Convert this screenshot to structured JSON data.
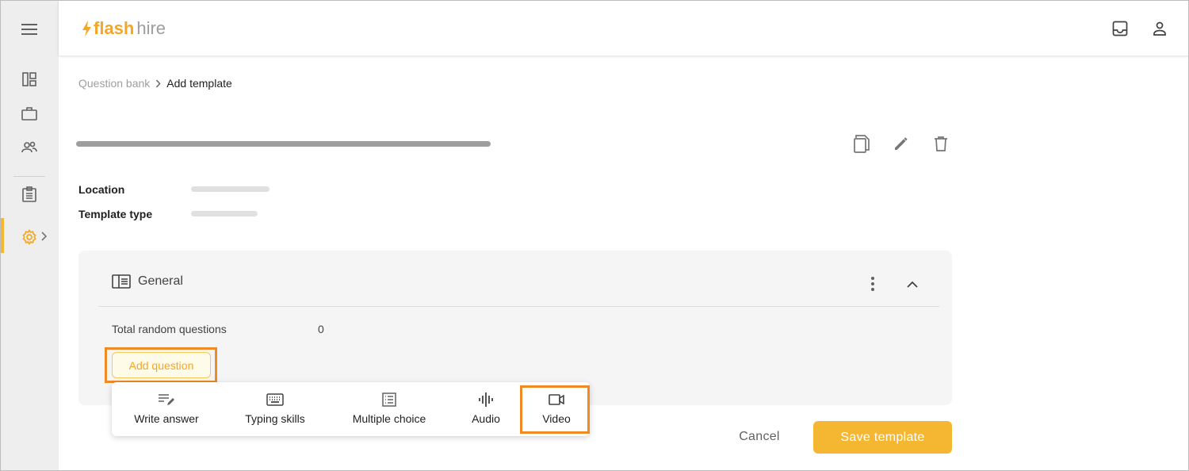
{
  "app": {
    "logo_flash": "flash",
    "logo_hire": "hire",
    "brand_color": "#f5b731",
    "highlight_color": "#f08a24"
  },
  "sidebar": {
    "items": [
      {
        "icon": "dashboard-icon"
      },
      {
        "icon": "briefcase-icon"
      },
      {
        "icon": "people-icon"
      },
      {
        "icon": "clipboard-icon"
      },
      {
        "icon": "settings-icon",
        "active": true
      }
    ]
  },
  "header": {
    "icons": [
      "inbox-icon",
      "user-icon"
    ]
  },
  "breadcrumb": {
    "parent": "Question bank",
    "current": "Add template"
  },
  "toolbar": {
    "icons": [
      "copy-icon",
      "edit-icon",
      "delete-icon"
    ]
  },
  "fields": {
    "location_label": "Location",
    "template_type_label": "Template type"
  },
  "section": {
    "title": "General",
    "random_label": "Total random questions",
    "random_value": "0",
    "add_question_label": "Add question"
  },
  "question_menu": {
    "items": [
      {
        "label": "Write answer",
        "icon": "write-answer-icon"
      },
      {
        "label": "Typing skills",
        "icon": "keyboard-icon"
      },
      {
        "label": "Multiple choice",
        "icon": "list-icon"
      },
      {
        "label": "Audio",
        "icon": "audio-icon"
      },
      {
        "label": "Video",
        "icon": "video-icon",
        "highlighted": true
      }
    ]
  },
  "actions": {
    "cancel_label": "Cancel",
    "save_label": "Save template"
  }
}
